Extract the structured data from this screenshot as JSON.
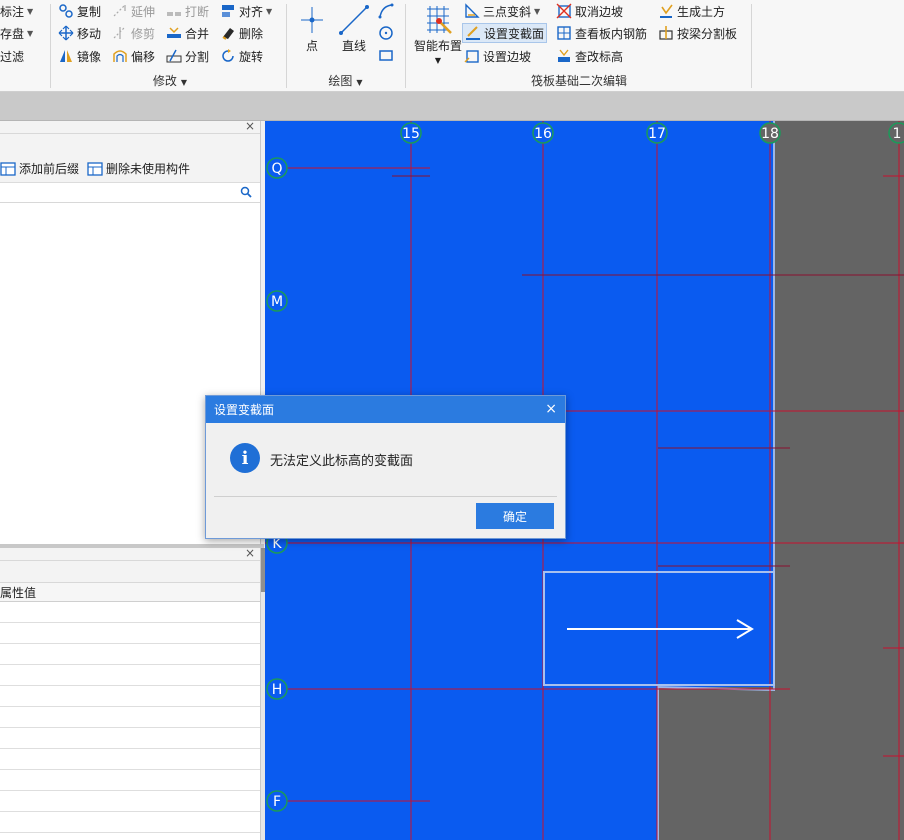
{
  "ribbon": {
    "col0": [
      "标注",
      "存盘",
      "过滤"
    ],
    "modify": {
      "copy": "复制",
      "extend": "延伸",
      "break": "打断",
      "align": "对齐",
      "move": "移动",
      "trim": "修剪",
      "merge": "合并",
      "delete": "删除",
      "mirror": "镜像",
      "offset": "偏移",
      "split": "分割",
      "rotate": "旋转",
      "label": "修改"
    },
    "draw": {
      "point": "点",
      "line": "直线",
      "label": "绘图"
    },
    "raft": {
      "smart_layout": "智能布置",
      "three_point_slope": "三点变斜",
      "set_section": "设置变截面",
      "set_slope": "设置边坡",
      "cancel_slope": "取消边坡",
      "view_rebar": "查看板内钢筋",
      "check_elevation": "查改标高",
      "gen_earthwork": "生成土方",
      "split_by_beam": "按梁分割板",
      "label": "筏板基础二次编辑"
    }
  },
  "left_panel": {
    "add_prefix": "添加前后缀",
    "delete_unused": "删除未使用构件"
  },
  "props_panel": {
    "col_value": "属性值"
  },
  "grid": {
    "columns": [
      "15",
      "16",
      "17",
      "18",
      "1"
    ],
    "rows": [
      "Q",
      "M",
      "K",
      "H",
      "F"
    ]
  },
  "dialog": {
    "title": "设置变截面",
    "message": "无法定义此标高的变截面",
    "ok": "确定"
  },
  "colors": {
    "canvas_blue": "#0a5bf0",
    "gray_area": "#646464",
    "grid_red": "#c8102e",
    "axis_green": "#1b9a5a",
    "dialog_blue": "#2b7be0"
  }
}
